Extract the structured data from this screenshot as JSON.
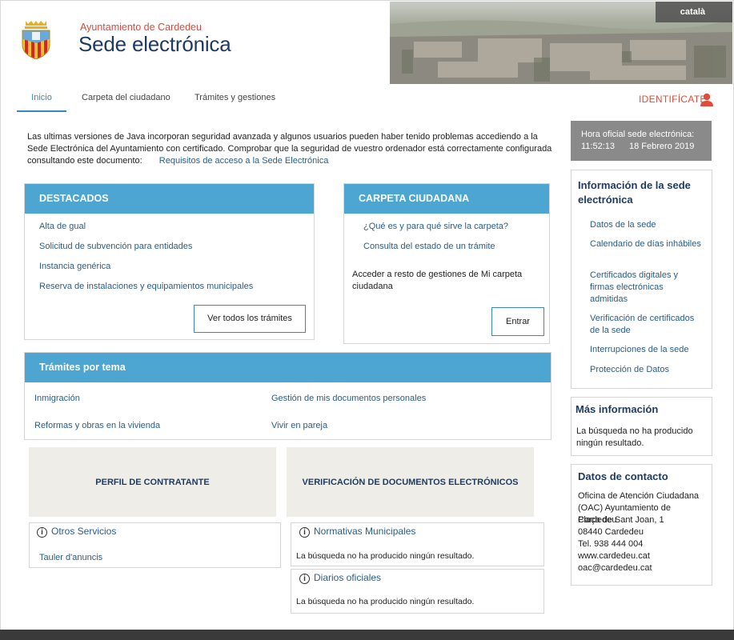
{
  "header": {
    "org_name": "Ayuntamiento de Cardedeu",
    "site_title": "Sede electrónica",
    "language_button": "català"
  },
  "nav": {
    "tabs": [
      {
        "label": "Inicio"
      },
      {
        "label": "Carpeta del ciudadano"
      },
      {
        "label": "Trámites y gestiones"
      }
    ],
    "login_label": "IDENTIFÍCATE"
  },
  "intro": {
    "text": "Las ultimas versiones de Java incorporan seguridad avanzada y algunos usuarios pueden haber tenido problemas accediendo a la Sede Electrónica del Ayuntamiento con certificado. Comprobar que la seguridad de vuestro ordenador está correctamente configurada consultando este documento:",
    "link": "Requisitos de acceso a la Sede Electrónica"
  },
  "official_time": {
    "label": "Hora oficial sede electrónica:",
    "time": "11:52:13",
    "date": "18 Febrero 2019"
  },
  "destacados": {
    "title": "DESTACADOS",
    "links": [
      "Alta de gual",
      "Solicitud de subvención para entidades",
      "Instancia genérica",
      "Reserva de instalaciones y equipamientos municipales"
    ],
    "button": "Ver todos los trámites"
  },
  "carpeta": {
    "title": "CARPETA CIUDADANA",
    "links": [
      "¿Qué es y para qué sirve la carpeta?",
      "Consulta del estado de un trámite"
    ],
    "text": "Acceder a resto de gestiones de Mi carpeta ciudadana",
    "button": "Entrar"
  },
  "tramites_tema": {
    "title": "Trámites por tema",
    "links": [
      "Inmigración",
      "Gestión de mis documentos personales",
      "Reformas y obras en la vivienda",
      "Vivir en pareja"
    ]
  },
  "cards": {
    "perfil": "PERFIL DE CONTRATANTE",
    "verificacion": "VERIFICACIÓN DE DOCUMENTOS ELECTRÓNICOS"
  },
  "otros_servicios": {
    "title": "Otros Servicios",
    "link": "Tauler d'anuncis"
  },
  "normativas": {
    "title": "Normativas Municipales",
    "text": "La búsqueda no ha producido ningún resultado."
  },
  "diarios": {
    "title": "Diarios oficiales",
    "text": "La búsqueda no ha producido ningún resultado."
  },
  "sidebar": {
    "info_title": "Información de la sede electrónica",
    "info_links": [
      "Datos de la sede",
      "Calendario de días inhábiles",
      "Certificados digitales y firmas electrónicas admitidas",
      "Verificación de certificados de la sede",
      "Interrupciones de la sede",
      "Protección de Datos"
    ],
    "more_title": "Más información",
    "more_text": "La búsqueda no ha producido ningún resultado.",
    "contact_title": "Datos de contacto",
    "contact_lines": [
      "Oficina de Atención Ciudadana (OAC) Ayuntamiento de Cardedeu",
      "Plaça de Sant Joan, 1",
      "08440 Cardedeu",
      "Tel. 938 444 004",
      "www.cardedeu.cat",
      "oac@cardedeu.cat"
    ]
  },
  "colors": {
    "accent": "#4da6d2",
    "brand_red": "#e24a3a",
    "title_navy": "#1f3b63"
  }
}
